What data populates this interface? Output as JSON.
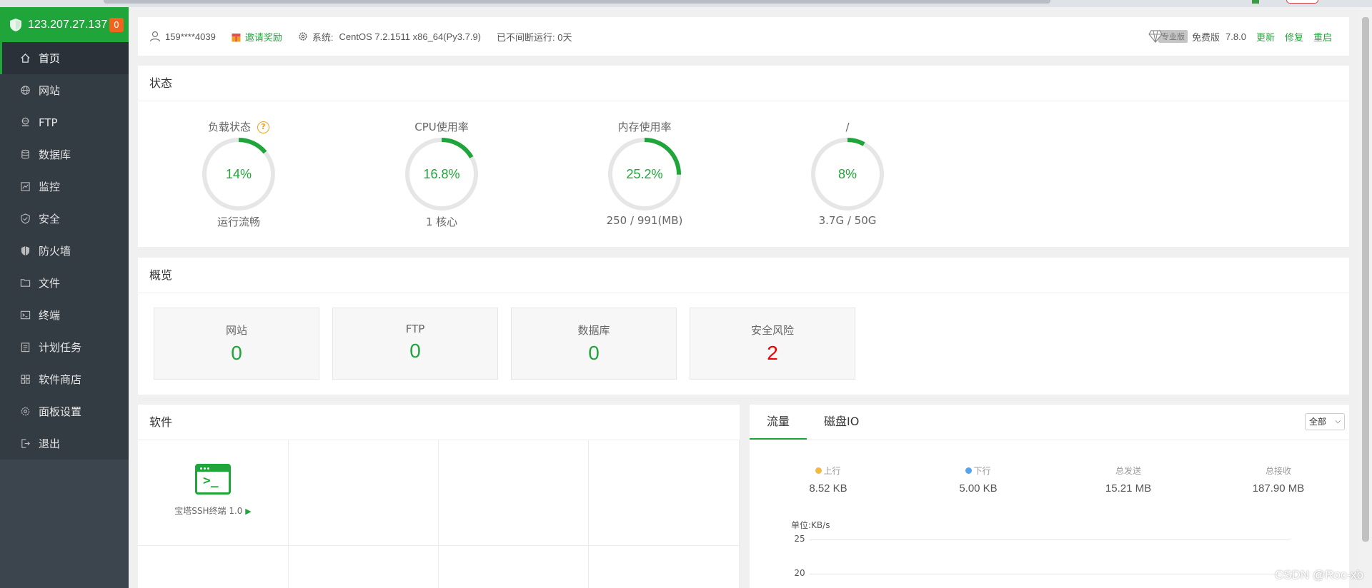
{
  "sidebar": {
    "ip": "123.207.27.137",
    "badge": "0",
    "items": [
      {
        "label": "首页",
        "icon": "home-icon"
      },
      {
        "label": "网站",
        "icon": "globe-icon"
      },
      {
        "label": "FTP",
        "icon": "ftp-icon"
      },
      {
        "label": "数据库",
        "icon": "database-icon"
      },
      {
        "label": "监控",
        "icon": "monitor-icon"
      },
      {
        "label": "安全",
        "icon": "shield-check-icon"
      },
      {
        "label": "防火墙",
        "icon": "firewall-icon"
      },
      {
        "label": "文件",
        "icon": "folder-icon"
      },
      {
        "label": "终端",
        "icon": "terminal-icon"
      },
      {
        "label": "计划任务",
        "icon": "calendar-icon"
      },
      {
        "label": "软件商店",
        "icon": "grid-icon"
      },
      {
        "label": "面板设置",
        "icon": "gear-icon"
      },
      {
        "label": "退出",
        "icon": "logout-icon"
      }
    ]
  },
  "infobar": {
    "user": "159****4039",
    "invite": "邀请奖励",
    "system_label": "系统:",
    "system_value": "CentOS 7.2.1511 x86_64(Py3.7.9)",
    "uptime": "已不间断运行: 0天",
    "pro_tag": "专业版",
    "edition": "免费版",
    "version": "7.8.0",
    "update": "更新",
    "repair": "修复",
    "restart": "重启"
  },
  "status": {
    "title": "状态",
    "gauges": [
      {
        "title": "负载状态",
        "value": "14%",
        "percent": 14,
        "sub": "运行流畅"
      },
      {
        "title": "CPU使用率",
        "value": "16.8%",
        "percent": 16.8,
        "sub": "1 核心"
      },
      {
        "title": "内存使用率",
        "value": "25.2%",
        "percent": 25.2,
        "sub": "250 / 991(MB)"
      },
      {
        "title": "/",
        "value": "8%",
        "percent": 8,
        "sub": "3.7G / 50G"
      }
    ]
  },
  "overview": {
    "title": "概览",
    "cards": [
      {
        "label": "网站",
        "value": "0"
      },
      {
        "label": "FTP",
        "value": "0"
      },
      {
        "label": "数据库",
        "value": "0"
      },
      {
        "label": "安全风险",
        "value": "2"
      }
    ]
  },
  "software": {
    "title": "软件",
    "app_name": "宝塔SSH终端 1.0",
    "play": "▶"
  },
  "traffic": {
    "tabs": [
      "流量",
      "磁盘IO"
    ],
    "select": "全部",
    "stats": [
      {
        "label": "上行",
        "value": "8.52 KB",
        "color": "#f4b844"
      },
      {
        "label": "下行",
        "value": "5.00 KB",
        "color": "#52a3f0"
      },
      {
        "label": "总发送",
        "value": "15.21 MB"
      },
      {
        "label": "总接收",
        "value": "187.90 MB"
      }
    ],
    "unit": "单位:KB/s",
    "axis": [
      "25",
      "20"
    ]
  },
  "watermark": "CSDN @Roc-xb",
  "colors": {
    "accent": "#20a53a",
    "danger": "#e00000",
    "sidebar": "#3c444d"
  }
}
